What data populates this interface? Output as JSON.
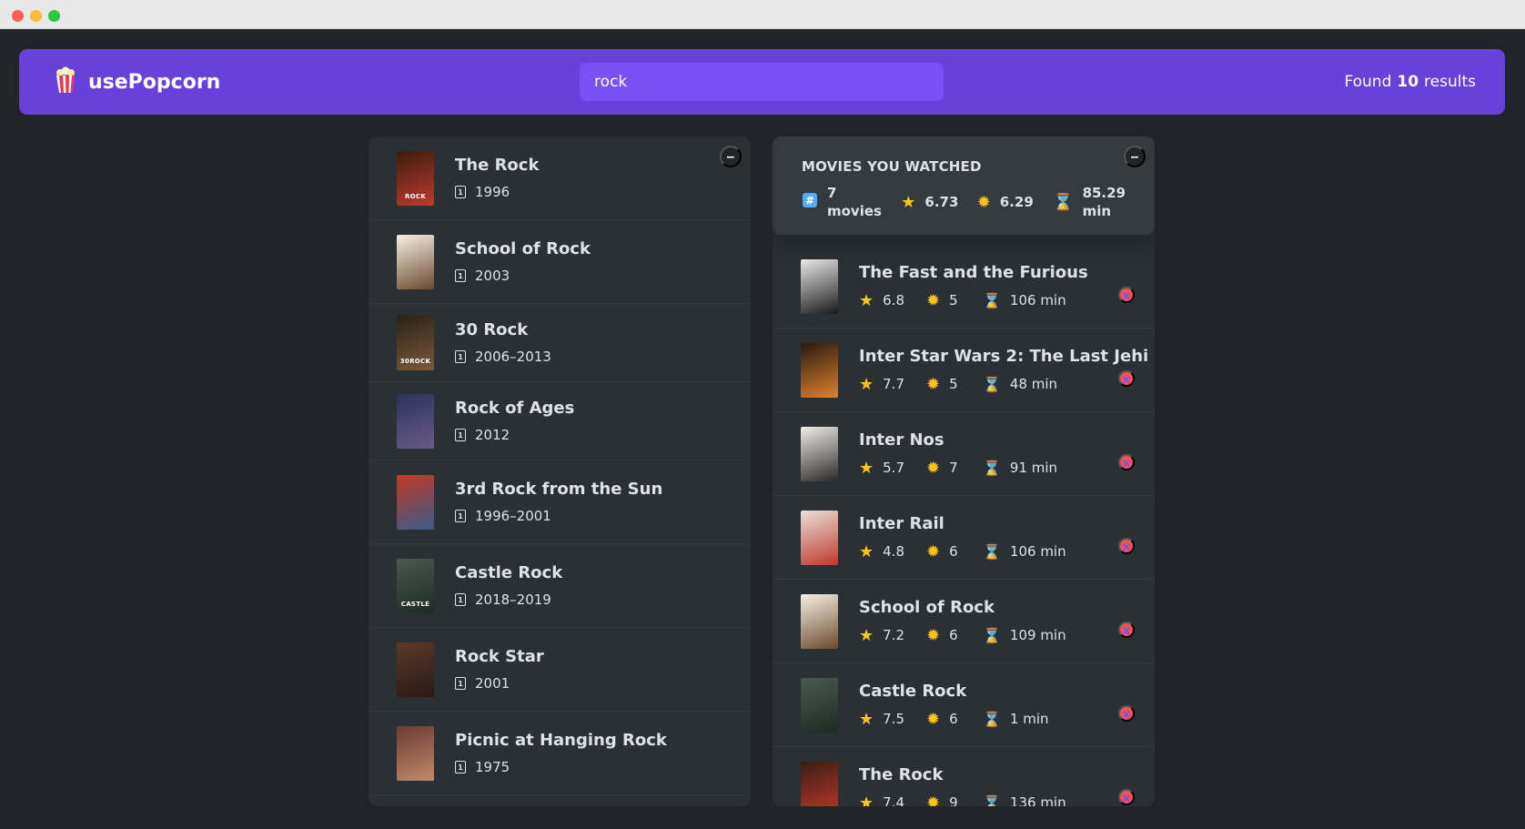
{
  "navbar": {
    "logo_icon": "popcorn-icon",
    "logo_text": "usePopcorn",
    "search_value": "rock",
    "results_prefix": "Found",
    "results_count": "10",
    "results_suffix": "results"
  },
  "search_list": {
    "toggle_label": "–",
    "movies": [
      {
        "title": "The Rock",
        "year": "1996",
        "poster_colors": [
          "#3a1e12",
          "#c0392b"
        ],
        "poster_text": "ROCK"
      },
      {
        "title": "School of Rock",
        "year": "2003",
        "poster_colors": [
          "#f5f0e6",
          "#6b4a2e"
        ],
        "poster_text": ""
      },
      {
        "title": "30 Rock",
        "year": "2006–2013",
        "poster_colors": [
          "#2a2218",
          "#7a5a3a"
        ],
        "poster_text": "30ROCK"
      },
      {
        "title": "Rock of Ages",
        "year": "2012",
        "poster_colors": [
          "#2a3358",
          "#6a5a8a"
        ],
        "poster_text": ""
      },
      {
        "title": "3rd Rock from the Sun",
        "year": "1996–2001",
        "poster_colors": [
          "#c23a22",
          "#3a5a8a"
        ],
        "poster_text": ""
      },
      {
        "title": "Castle Rock",
        "year": "2018–2019",
        "poster_colors": [
          "#4a5a50",
          "#1e2a24"
        ],
        "poster_text": "CASTLE"
      },
      {
        "title": "Rock Star",
        "year": "2001",
        "poster_colors": [
          "#5a3a2a",
          "#2a1a14"
        ],
        "poster_text": ""
      },
      {
        "title": "Picnic at Hanging Rock",
        "year": "1975",
        "poster_colors": [
          "#6a3a34",
          "#c28a6a"
        ],
        "poster_text": ""
      }
    ]
  },
  "watched": {
    "toggle_label": "–",
    "summary_title": "MOVIES YOU WATCHED",
    "count_value": "7",
    "count_unit": "movies",
    "avg_imdb": "6.73",
    "avg_user": "6.29",
    "avg_runtime_value": "85.29",
    "avg_runtime_unit": "min",
    "movies": [
      {
        "title": "The Fast and the Furious",
        "imdb": "6.8",
        "user": "5",
        "runtime": "106 min",
        "poster_colors": [
          "#e8e8e8",
          "#1a1a1a"
        ]
      },
      {
        "title": "Inter Star Wars 2: The Last Jehi",
        "imdb": "7.7",
        "user": "5",
        "runtime": "48 min",
        "poster_colors": [
          "#2a1a0e",
          "#e08030"
        ]
      },
      {
        "title": "Inter Nos",
        "imdb": "5.7",
        "user": "7",
        "runtime": "91 min",
        "poster_colors": [
          "#f0ece6",
          "#2a2a2a"
        ]
      },
      {
        "title": "Inter Rail",
        "imdb": "4.8",
        "user": "6",
        "runtime": "106 min",
        "poster_colors": [
          "#e8e0d8",
          "#c0392b"
        ]
      },
      {
        "title": "School of Rock",
        "imdb": "7.2",
        "user": "6",
        "runtime": "109 min",
        "poster_colors": [
          "#f5f0e6",
          "#6b4a2e"
        ]
      },
      {
        "title": "Castle Rock",
        "imdb": "7.5",
        "user": "6",
        "runtime": "1 min",
        "poster_colors": [
          "#4a5a50",
          "#1e2a24"
        ]
      },
      {
        "title": "The Rock",
        "imdb": "7.4",
        "user": "9",
        "runtime": "136 min",
        "poster_colors": [
          "#3a1e12",
          "#c0392b"
        ]
      }
    ]
  }
}
